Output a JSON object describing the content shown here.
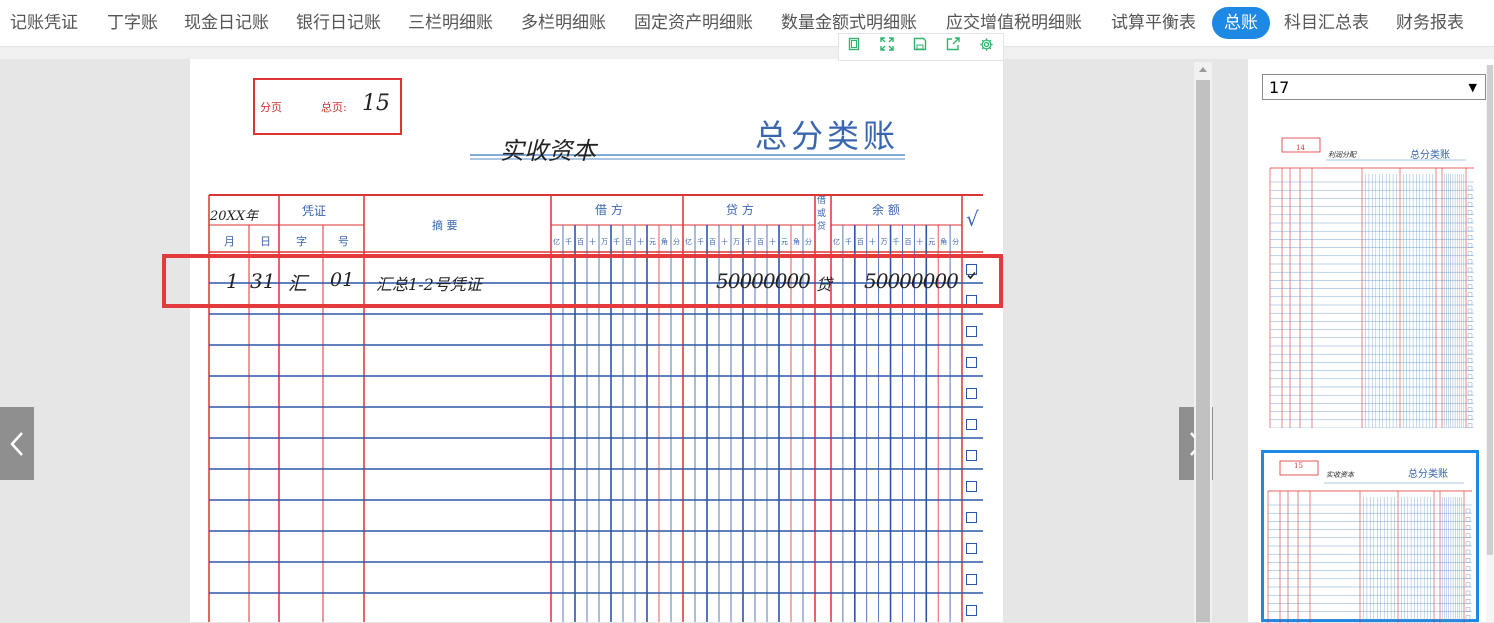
{
  "nav": {
    "tabs": [
      {
        "label": "记账凭证",
        "active": false
      },
      {
        "label": "丁字账",
        "active": false
      },
      {
        "label": "现金日记账",
        "active": false
      },
      {
        "label": "银行日记账",
        "active": false
      },
      {
        "label": "三栏明细账",
        "active": false
      },
      {
        "label": "多栏明细账",
        "active": false
      },
      {
        "label": "固定资产明细账",
        "active": false
      },
      {
        "label": "数量金额式明细账",
        "active": false
      },
      {
        "label": "应交增值税明细账",
        "active": false
      },
      {
        "label": "试算平衡表",
        "active": false
      },
      {
        "label": "总账",
        "active": true
      },
      {
        "label": "科目汇总表",
        "active": false
      },
      {
        "label": "财务报表",
        "active": false
      }
    ],
    "active_color": "#1e88e5"
  },
  "toolbar": {
    "icons": [
      "copy-icon",
      "fullscreen-icon",
      "save-icon",
      "share-icon",
      "settings-icon"
    ]
  },
  "ledger": {
    "stamp": {
      "fenye": "分页",
      "zongye": "总页:",
      "page_no": "15"
    },
    "account_name": "实收资本",
    "title": "总分类账",
    "headers": {
      "year": "20XX年",
      "voucher": "凭证",
      "summary": "摘 要",
      "debit": "借 方",
      "credit": "贷 方",
      "dc": "借或贷",
      "balance": "余 额",
      "check": "√",
      "month": "月",
      "day": "日",
      "type": "字",
      "number": "号",
      "digits": [
        "亿",
        "千",
        "百",
        "十",
        "万",
        "千",
        "百",
        "十",
        "元",
        "角",
        "分"
      ]
    },
    "entry": {
      "month": "1",
      "day": "31",
      "type": "汇",
      "number": "01",
      "summary": "汇总1-2号凭证",
      "credit": "50000000",
      "dc": "贷",
      "balance": "50000000",
      "checked": true
    }
  },
  "sidebar": {
    "page_select": "17",
    "thumbs": [
      {
        "page_no": "14",
        "account": "利润分配",
        "title": "总分类账",
        "selected": false
      },
      {
        "page_no": "15",
        "account": "实收资本",
        "title": "总分类账",
        "selected": true
      }
    ]
  }
}
